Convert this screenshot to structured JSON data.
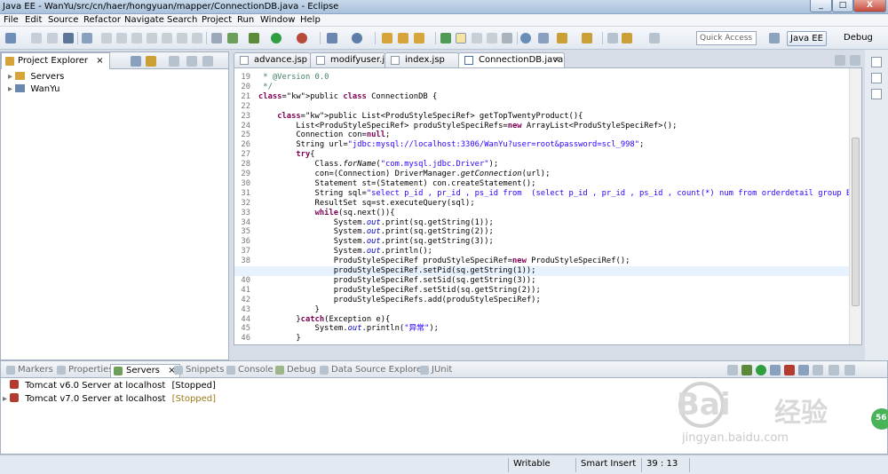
{
  "window": {
    "title": "Java EE - WanYu/src/cn/haer/hongyuan/mapper/ConnectionDB.java - Eclipse",
    "controls": [
      "_",
      "□",
      "X"
    ]
  },
  "menu": [
    "File",
    "Edit",
    "Source",
    "Refactor",
    "Navigate",
    "Search",
    "Project",
    "Run",
    "Window",
    "Help"
  ],
  "toolbar": {
    "quick_access": "Quick Access",
    "perspective_java_ee": "Java EE",
    "perspective_debug": "Debug"
  },
  "project_explorer": {
    "title": "Project Explorer",
    "close": "×",
    "items": [
      "Servers",
      "WanYu"
    ]
  },
  "editor": {
    "tabs": [
      "advance.jsp",
      "modifyuser.jsp",
      "index.jsp",
      "ConnectionDB.java"
    ],
    "close": "×",
    "current_line": "39",
    "lines": [
      {
        "n": "19",
        "t": " * @Version 0.0"
      },
      {
        "n": "20",
        "t": " */"
      },
      {
        "n": "21",
        "t": "public class ConnectionDB {"
      },
      {
        "n": "22",
        "t": ""
      },
      {
        "n": "23",
        "t": "    public List<ProduStyleSpeciRef> getTopTwentyProduct(){"
      },
      {
        "n": "24",
        "t": "        List<ProduStyleSpeciRef> produStyleSpeciRefs=new ArrayList<ProduStyleSpeciRef>();"
      },
      {
        "n": "25",
        "t": "        Connection con=null;"
      },
      {
        "n": "26",
        "t": "        String url=\"jdbc:mysql://localhost:3306/WanYu?user=root&password=scl_998\";"
      },
      {
        "n": "27",
        "t": "        try{"
      },
      {
        "n": "28",
        "t": "            Class.forName(\"com.mysql.jdbc.Driver\");"
      },
      {
        "n": "29",
        "t": "            con=(Connection) DriverManager.getConnection(url);"
      },
      {
        "n": "30",
        "t": "            Statement st=(Statement) con.createStatement();"
      },
      {
        "n": "31",
        "t": "            String sql=\"select p_id , pr_id , ps_id from  (select p_id , pr_id , ps_id , count(*) num from orderdetail group BY p"
      },
      {
        "n": "32",
        "t": "            ResultSet sq=st.executeQuery(sql);"
      },
      {
        "n": "33",
        "t": "            while(sq.next()){"
      },
      {
        "n": "34",
        "t": "                System.out.print(sq.getString(1));"
      },
      {
        "n": "35",
        "t": "                System.out.print(sq.getString(2));"
      },
      {
        "n": "36",
        "t": "                System.out.print(sq.getString(3));"
      },
      {
        "n": "37",
        "t": "                System.out.println();"
      },
      {
        "n": "38",
        "t": "                ProduStyleSpeciRef produStyleSpeciRef=new ProduStyleSpeciRef();"
      },
      {
        "n": "39",
        "t": "                produStyleSpeciRef.setPid(sq.getString(1));"
      },
      {
        "n": "40",
        "t": "                produStyleSpeciRef.setSid(sq.getString(3));"
      },
      {
        "n": "41",
        "t": "                produStyleSpeciRef.setStid(sq.getString(2));"
      },
      {
        "n": "42",
        "t": "                produStyleSpeciRefs.add(produStyleSpeciRef);"
      },
      {
        "n": "43",
        "t": "            }"
      },
      {
        "n": "44",
        "t": "        }catch(Exception e){"
      },
      {
        "n": "45",
        "t": "            System.out.println(\"异常\");"
      },
      {
        "n": "46",
        "t": "        }"
      }
    ]
  },
  "bottom_panel": {
    "tabs": [
      "Markers",
      "Properties",
      "Servers",
      "Snippets",
      "Console",
      "Debug",
      "Data Source Explorer",
      "JUnit"
    ],
    "active_tab": "Servers",
    "close": "×",
    "servers": [
      {
        "name": "Tomcat v6.0 Server at localhost",
        "state": "[Stopped]"
      },
      {
        "name": "Tomcat v7.0 Server at localhost",
        "state": "[Stopped]"
      }
    ]
  },
  "status": {
    "writable": "Writable",
    "insert_mode": "Smart Insert",
    "position": "39 : 13"
  },
  "watermark": {
    "brand": "Bai",
    "brand_cn": "经验",
    "url": "jingyan.baidu.com",
    "badge": "56"
  },
  "colors": {
    "keyword": "#7f0055",
    "string": "#2a00ff",
    "comment": "#3f7f5f",
    "field": "#0000c0",
    "current_line": "#e8f2fe"
  }
}
